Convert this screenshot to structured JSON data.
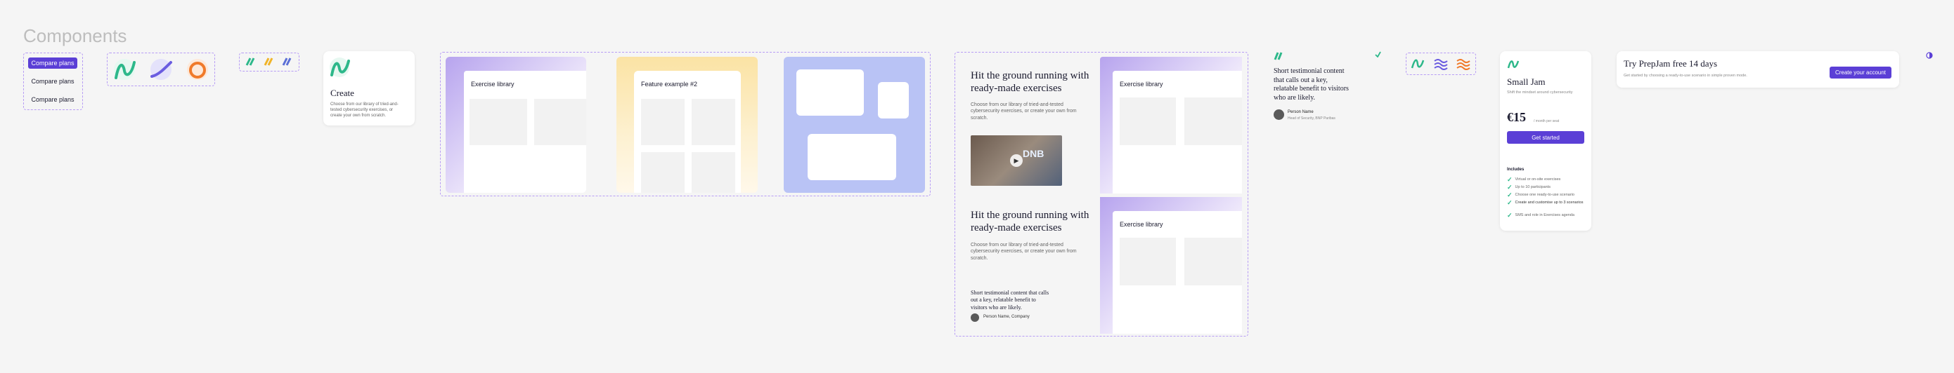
{
  "page": {
    "title": "Components"
  },
  "buttons": {
    "primary": "Compare plans",
    "secondary1": "Compare plans",
    "secondary2": "Compare plans"
  },
  "create_card": {
    "title": "Create",
    "desc": "Choose from our library of tried-and-tested cybersecurity exercises, or create your own from scratch."
  },
  "panels": {
    "panel1_label": "Exercise library",
    "panel2_label": "Feature example #2"
  },
  "hero": {
    "headline": "Hit the ground running with ready-made exercises",
    "body": "Choose from our library of tried-and-tested cybersecurity exercises, or create your own from scratch.",
    "panel_label": "Exercise library",
    "video_logo": "DNB",
    "testimonial": "Short testimonial content that calls out a key, relatable benefit to visitors who are likely.",
    "person": "Person Name, Company"
  },
  "testimonial": {
    "quote": "Short testimonial content that calls out a key, relatable benefit to visitors who are likely.",
    "name": "Person Name",
    "role": "Head of Security, BNP Paribas"
  },
  "pricing": {
    "plan": "Small Jam",
    "desc": "Shift the mindset around cybersecurity",
    "price": "€15",
    "per": "/ month per seat",
    "cta": "Get started",
    "includes": "Includes",
    "features": [
      "Virtual or on-site exercises",
      "Up to 10 participants",
      "Choose one ready-to-use scenario",
      "Create and customise up to 3 scenarios",
      "SMS and role in Exercises agenda"
    ]
  },
  "trial": {
    "title": "Try PrepJam free 14 days",
    "desc": "Get started by choosing a ready-to-use scenario in simple proven mode.",
    "cta": "Create your account"
  },
  "colors": {
    "accent": "#5b3fd6",
    "green": "#2db88a",
    "orange": "#f07a2a",
    "dash": "#b79cf5"
  }
}
